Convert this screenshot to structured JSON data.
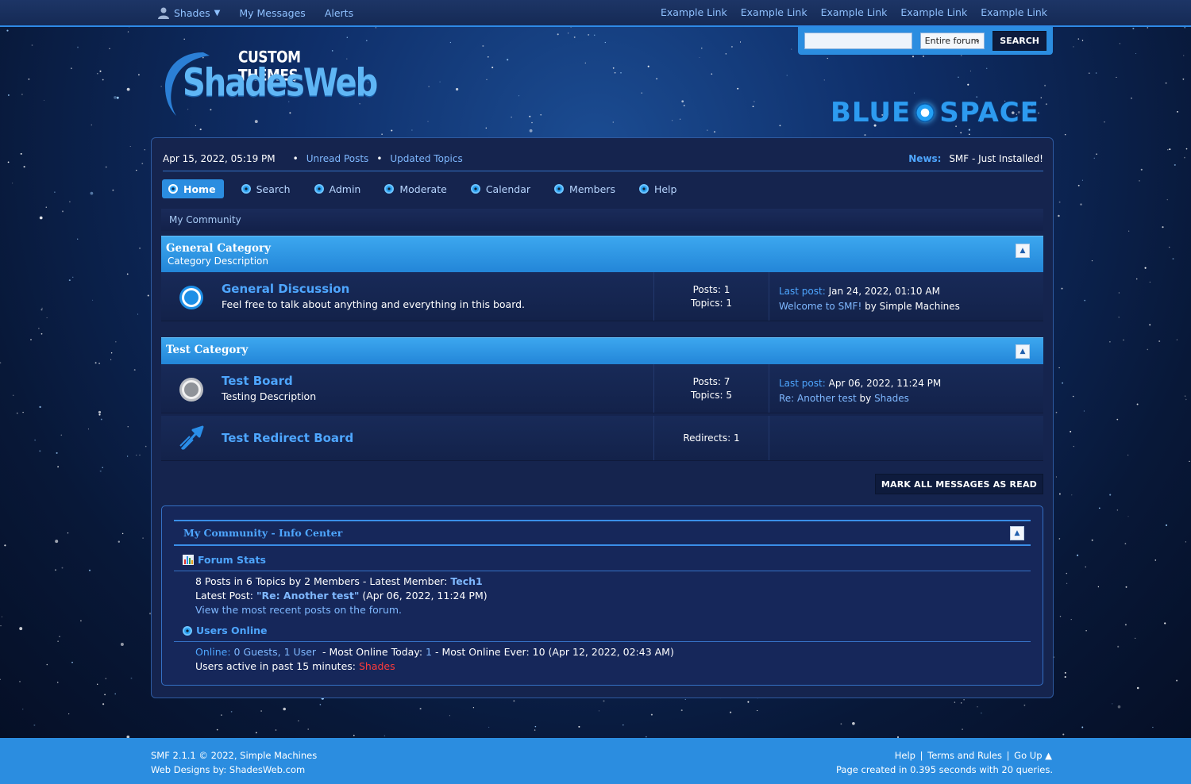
{
  "topbar": {
    "user_name": "Shades",
    "my_messages": "My Messages",
    "alerts": "Alerts",
    "example_links": [
      "Example Link",
      "Example Link",
      "Example Link",
      "Example Link",
      "Example Link"
    ]
  },
  "search": {
    "placeholder": "",
    "scope": "Entire forum",
    "button": "SEARCH"
  },
  "logo": {
    "custom_themes": "CUSTOM THEMES",
    "name": "ShadesWeb",
    "theme_left": "BLUE",
    "theme_right": "SPACE"
  },
  "upper": {
    "date": "Apr 15, 2022, 05:19 PM",
    "unread": "Unread Posts",
    "updated": "Updated Topics",
    "news_label": "News:",
    "news_text": "SMF - Just Installed!"
  },
  "menu": {
    "items": [
      "Home",
      "Search",
      "Admin",
      "Moderate",
      "Calendar",
      "Members",
      "Help"
    ]
  },
  "breadcrumb": "My Community",
  "categories": [
    {
      "title": "General Category",
      "description": "Category Description",
      "boards": [
        {
          "name": "General Discussion",
          "description": "Feel free to talk about anything and everything in this board.",
          "posts": "Posts: 1",
          "topics": "Topics: 1",
          "last_post_label": "Last post:",
          "last_post_date": "Jan 24, 2022, 01:10 AM",
          "last_post_topic": "Welcome to SMF!",
          "by": "by",
          "last_post_author": "Simple Machines"
        }
      ]
    },
    {
      "title": "Test Category",
      "boards": [
        {
          "name": "Test Board",
          "description": "Testing Description",
          "posts": "Posts: 7",
          "topics": "Topics: 5",
          "last_post_label": "Last post:",
          "last_post_date": "Apr 06, 2022, 11:24 PM",
          "last_post_topic": "Re: Another test",
          "by": "by",
          "last_post_author": "Shades"
        },
        {
          "name": "Test Redirect Board",
          "redirects": "Redirects: 1"
        }
      ]
    }
  ],
  "mark_all_read": "MARK ALL MESSAGES AS READ",
  "info_center": {
    "title": "My Community - Info Center",
    "forum_stats_title": "Forum Stats",
    "stats_line1_prefix": "8 Posts in 6 Topics by 2 Members - Latest Member:",
    "latest_member": "Tech1",
    "latest_post_prefix": "Latest Post:",
    "latest_post_link": "\"Re: Another test\"",
    "latest_post_date": "(Apr 06, 2022, 11:24 PM)",
    "recent_link": "View the most recent posts on the forum.",
    "users_online_title": "Users Online",
    "online_label": "Online:",
    "online_counts": "0 Guests, 1 User",
    "most_today_label": "- Most Online Today:",
    "most_today_value": "1",
    "most_ever": "-  Most Online Ever: 10 (Apr 12, 2022, 02:43 AM)",
    "active_label": "Users active in past 15 minutes:",
    "active_user": "Shades"
  },
  "footer": {
    "copyright": "SMF 2.1.1 © 2022, Simple Machines",
    "designs_label": "Web Designs by:",
    "designs_site": "ShadesWeb.com",
    "help": "Help",
    "terms": "Terms and Rules",
    "go_up": "Go Up ▲",
    "sep": "|",
    "page_created": "Page created in 0.395 seconds with 20 queries."
  },
  "colors": {
    "accent": "#2b8de0",
    "panel": "#15244e",
    "link": "#7fb8ff",
    "highlight_link": "#4ea6ff",
    "online_user": "#ff3b3b"
  }
}
